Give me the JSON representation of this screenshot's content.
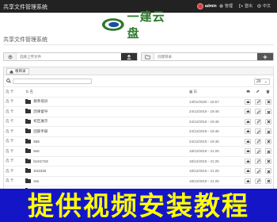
{
  "header": {
    "title": "共享文件管理系统",
    "user": "admin",
    "nav": [
      {
        "label": "管理",
        "icon": "gear-icon"
      },
      {
        "label": "登出",
        "icon": "logout-icon"
      },
      {
        "label": "中文",
        "icon": "globe-icon"
      }
    ]
  },
  "brand": {
    "logo_text": "一建云盘"
  },
  "page_title": "共享文件管理系统",
  "upload": {
    "placeholder": "选择上传文件",
    "icon": "upload-icon",
    "button_icon": "upload-arrow-icon"
  },
  "create_folder": {
    "placeholder": "创建目录",
    "icon": "folder-icon",
    "button_icon": "plus-icon"
  },
  "breadcrumb": {
    "label": "根目录",
    "icon": "home-icon"
  },
  "page_size": "20",
  "table": {
    "headers": {
      "name": "名",
      "date": "日"
    },
    "check_label": "选 卡",
    "rows": [
      {
        "name": "教师培训",
        "date": "13/01/2020 - 15:57"
      },
      {
        "name": "因果督导",
        "date": "24/12/2019 - 19:46"
      },
      {
        "name": "校区展示",
        "date": "24/12/2019 - 19:46"
      },
      {
        "name": "团部手册",
        "date": "24/12/2019 - 19:46"
      },
      {
        "name": "555",
        "date": "24/12/2019 - 19:46"
      },
      {
        "name": "test",
        "date": "18/12/2019 - 21:25"
      },
      {
        "name": "bzxt1718",
        "date": "18/12/2019 - 21:25"
      },
      {
        "name": "SS2332",
        "date": "18/12/2019 - 21:25"
      },
      {
        "name": "sss",
        "date": "18/12/2019 - 21:25"
      },
      {
        "name": "明明库",
        "date": "18/12/2019 - 21:25"
      }
    ]
  },
  "banner": {
    "text": "提供视频安装教程"
  },
  "colors": {
    "topbar": "#222222",
    "brand_green": "#2d7a2d",
    "banner_bg": "#1515c8",
    "banner_text": "#ffff00"
  }
}
